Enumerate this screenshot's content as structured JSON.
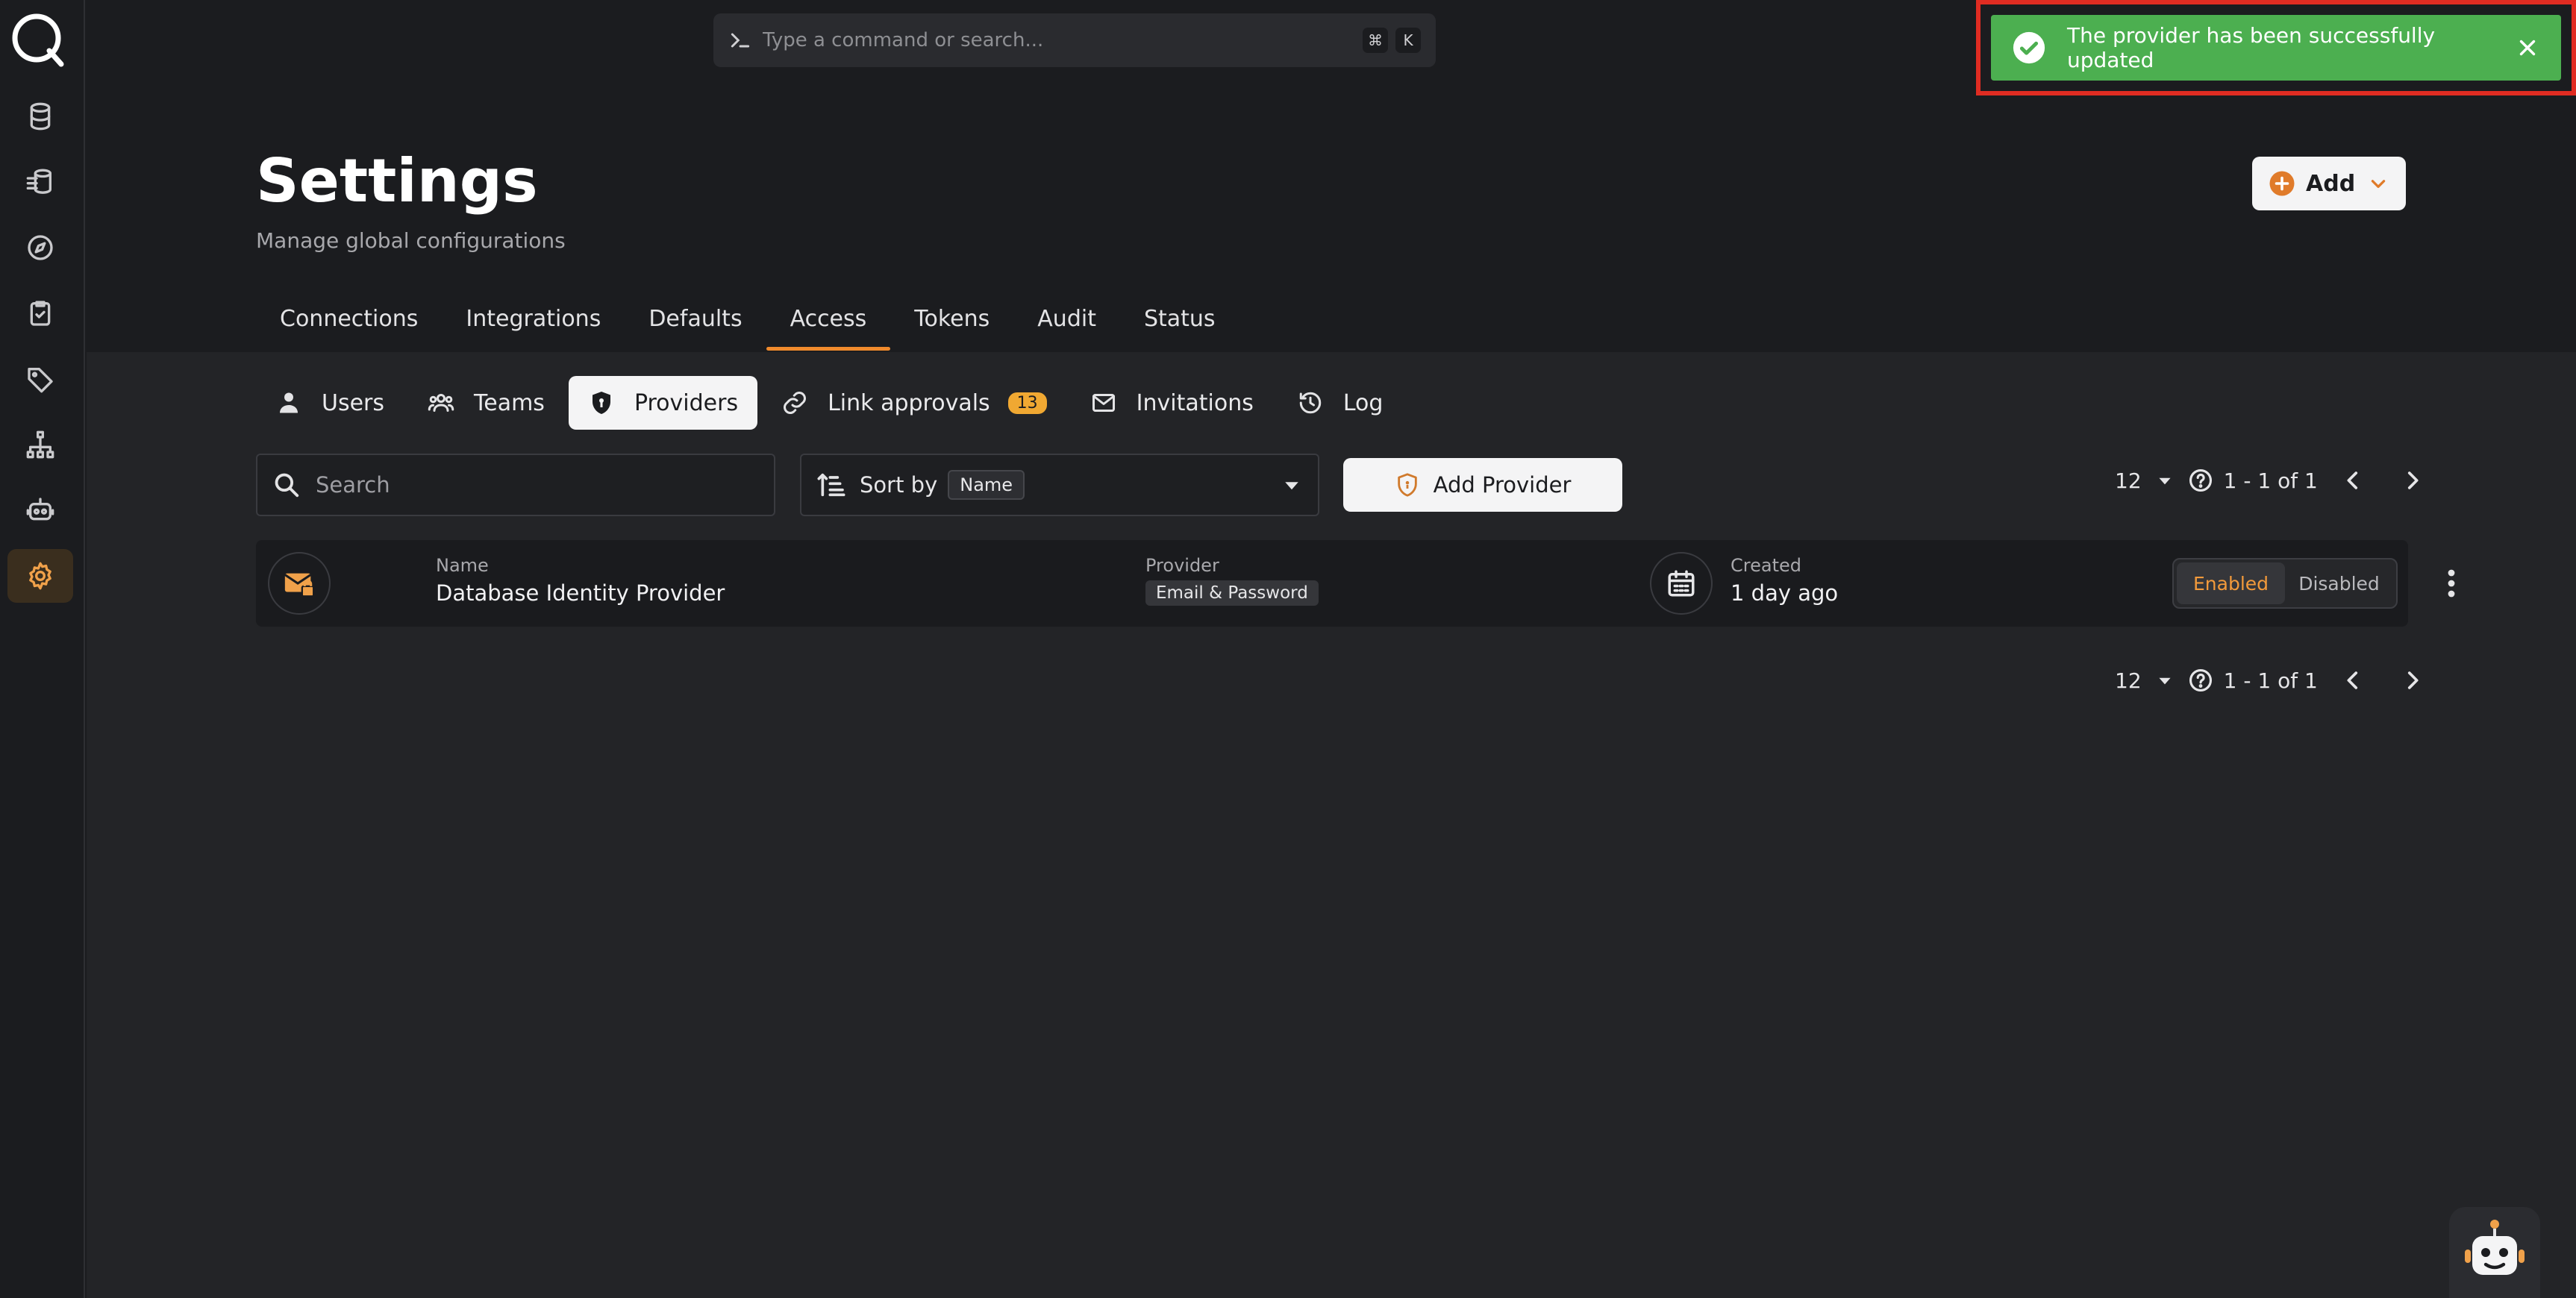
{
  "command_bar": {
    "placeholder": "Type a command or search...",
    "kbd_cmd": "⌘",
    "kbd_key": "K"
  },
  "toast": {
    "message": "The provider has been successfully updated"
  },
  "header": {
    "title": "Settings",
    "subtitle": "Manage global configurations",
    "add_label": "Add"
  },
  "rail": {
    "items": [
      {
        "name": "database-icon"
      },
      {
        "name": "pipeline-icon"
      },
      {
        "name": "compass-icon"
      },
      {
        "name": "clipboard-check-icon"
      },
      {
        "name": "tag-icon"
      },
      {
        "name": "hierarchy-icon"
      },
      {
        "name": "robot-icon"
      },
      {
        "name": "gear-icon",
        "active": true
      }
    ]
  },
  "tabs": [
    "Connections",
    "Integrations",
    "Defaults",
    "Access",
    "Tokens",
    "Audit",
    "Status"
  ],
  "active_tab": "Access",
  "subtabs": {
    "users": "Users",
    "teams": "Teams",
    "providers": "Providers",
    "link_approvals": "Link approvals",
    "link_approvals_count": "13",
    "invitations": "Invitations",
    "log": "Log"
  },
  "toolbar": {
    "search_placeholder": "Search",
    "sort_label": "Sort by",
    "sort_value": "Name",
    "add_provider": "Add Provider"
  },
  "pagination": {
    "per_page": "12",
    "range": "1 - 1 of 1"
  },
  "row": {
    "name_label": "Name",
    "name": "Database Identity Provider",
    "provider_label": "Provider",
    "provider": "Email & Password",
    "created_label": "Created",
    "created": "1 day ago",
    "enabled": "Enabled",
    "disabled": "Disabled",
    "state": "Enabled"
  },
  "colors": {
    "accent": "#f08a2c",
    "toast_bg": "#4caf50",
    "highlight": "#e02c22"
  }
}
